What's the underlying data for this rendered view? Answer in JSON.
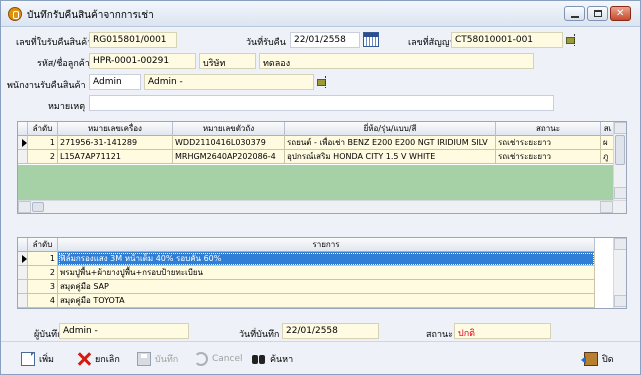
{
  "window": {
    "title": "บันทึกรับคืนสินค้าจากการเช่า",
    "icon": "app-coin-icon"
  },
  "header": {
    "doc_no_label": "เลขที่ใบรับคืนสินค้า",
    "doc_no": "RG015801/0001",
    "return_date_label": "วันที่รับคืน",
    "return_date": "22/01/2558",
    "contract_no_label": "เลขที่สัญญา",
    "contract_no": "CT58010001-001",
    "customer_label": "รหัส/ชื่อลูกค้า",
    "customer_code": "HPR-0001-00291",
    "customer_type": "บริษัท",
    "customer_name": "ทดลอง",
    "receiver_label": "พนักงานรับคืนสินค้า",
    "receiver_code": "Admin",
    "receiver_name": "Admin -",
    "remark_label": "หมายเหตุ",
    "remark": ""
  },
  "items_grid": {
    "columns": [
      "ลำดับ",
      "หมายเลขเครื่อง",
      "หมายเลขตัวถัง",
      "ยี่ห้อ/รุ่น/แบบ/สี",
      "สถานะ",
      "สเ"
    ],
    "rows": [
      {
        "no": "1",
        "engine_no": "271956-31-141289",
        "chassis_no": "WDD2110416L030379",
        "model": "รถยนต์ - เพื่อเช่า BENZ E200 E200 NGT IRIDIUM SILV",
        "status": "รถเช่าระยะยาว",
        "extra": "ผ"
      },
      {
        "no": "2",
        "engine_no": "L15A7AP71121",
        "chassis_no": "MRHGM2640AP202086-4",
        "model": "อุปกรณ์เสริม HONDA CITY 1.5 V WHITE",
        "status": "รถเช่าระยะยาว",
        "extra": "ภู"
      }
    ]
  },
  "accessories_grid": {
    "columns": [
      "ลำดับ",
      "รายการ"
    ],
    "rows": [
      {
        "no": "1",
        "item": "ฟิล์มกรองแสง 3M หน้าเต็ม 40% รอบคัน 60%"
      },
      {
        "no": "2",
        "item": "พรมปูพื้น+ผ้ายางปูพื้น+กรอบป้ายทะเบียน"
      },
      {
        "no": "3",
        "item": "สมุดคู่มือ SAP"
      },
      {
        "no": "4",
        "item": "สมุดคู่มือ TOYOTA"
      }
    ]
  },
  "footer": {
    "recorded_by_label": "ผู้บันทึก",
    "recorded_by": "Admin -",
    "record_date_label": "วันที่บันทึก",
    "record_date": "22/01/2558",
    "status_label": "สถานะ",
    "status": "ปกติ",
    "status_color": "#e0001a"
  },
  "toolbar": {
    "new_label": "เพิ่ม",
    "cancel_label": "ยกเลิก",
    "save_label": "บันทึก",
    "undo_label": "Cancel",
    "find_label": "ค้นหา",
    "close_label": "ปิด"
  }
}
